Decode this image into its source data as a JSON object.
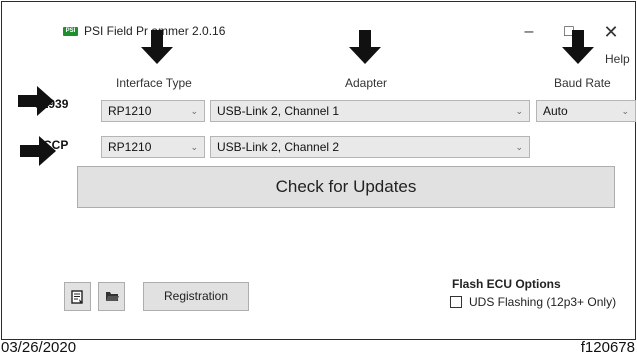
{
  "window": {
    "logo_text": "PSI",
    "title": "PSI Field Pr   ammer 2.0.16",
    "minimize_glyph": "–",
    "maximize_glyph": "□",
    "close_glyph": "✕",
    "help_label": "Help"
  },
  "columns": {
    "interface_type": "Interface Type",
    "adapter": "Adapter",
    "baud_rate": "Baud Rate"
  },
  "rows": [
    {
      "label": "J1939",
      "interface": "RP1210",
      "adapter": "USB-Link 2, Channel 1",
      "baud": "Auto"
    },
    {
      "label": "CCP",
      "interface": "RP1210",
      "adapter": "USB-Link 2, Channel 2"
    }
  ],
  "buttons": {
    "check_updates": "Check for Updates",
    "registration": "Registration",
    "doc_icon": "document-icon",
    "folder_icon": "folder-icon"
  },
  "flash": {
    "title": "Flash ECU Options",
    "option": "UDS Flashing (12p3+ Only)",
    "checked": false
  },
  "footer": {
    "date": "03/26/2020",
    "ref": "f120678"
  },
  "colors": {
    "logo": "#1e8f2e",
    "arrow": "#111111",
    "button_bg": "#e1e1e1"
  }
}
